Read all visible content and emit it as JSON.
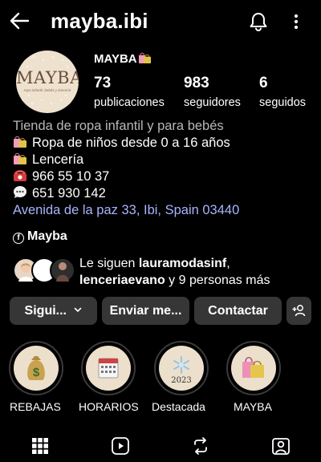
{
  "header": {
    "username": "mayba.ibi",
    "back_icon": "arrow-left-icon",
    "bell_icon": "bell-icon",
    "menu_icon": "more-vertical-icon"
  },
  "profile": {
    "avatar_logo": "MAYBA",
    "avatar_tagline": "ropa infantil, bebés y lencería",
    "display_name": "MAYBA",
    "stats": [
      {
        "value": "73",
        "label": "publicaciones"
      },
      {
        "value": "983",
        "label": "seguidores"
      },
      {
        "value": "6",
        "label": "seguidos"
      }
    ]
  },
  "bio": {
    "category": "Tienda de ropa infantil y para bebés",
    "lines": [
      {
        "icon": "shopping-bags-icon",
        "text": "Ropa de niños desde 0 a 16 años"
      },
      {
        "icon": "shopping-bags-icon",
        "text": "Lencería"
      },
      {
        "icon": "telephone-icon",
        "text": "966 55 10 37"
      },
      {
        "icon": "speech-bubble-icon",
        "text": "651 930 142"
      }
    ],
    "address": "Avenida de la paz 33, Ibi, Spain 03440",
    "facebook_label": "Mayba",
    "facebook_icon": "facebook-icon"
  },
  "followed_by": {
    "prefix": "Le siguen ",
    "user1": "lauramodasinf",
    "separator": ",",
    "user2": "lenceriaevano",
    "suffix": " y 9 personas más"
  },
  "actions": {
    "following": "Sigui...",
    "message": "Enviar me...",
    "contact": "Contactar",
    "add_person_icon": "add-person-icon"
  },
  "highlights": [
    {
      "label": "REBAJAS",
      "icon": "money-bag-icon"
    },
    {
      "label": "HORARIOS",
      "icon": "calendar-icon"
    },
    {
      "label": "Destacada",
      "icon": "snowflake-2023-icon",
      "caption": "2023"
    },
    {
      "label": "MAYBA",
      "icon": "shopping-bags-icon"
    }
  ],
  "tabs": [
    "grid-icon",
    "reels-icon",
    "reposts-icon",
    "tagged-icon"
  ],
  "colors": {
    "background": "#000000",
    "button": "#363636",
    "link": "#a8b4ff",
    "muted": "#b8b8b8"
  }
}
